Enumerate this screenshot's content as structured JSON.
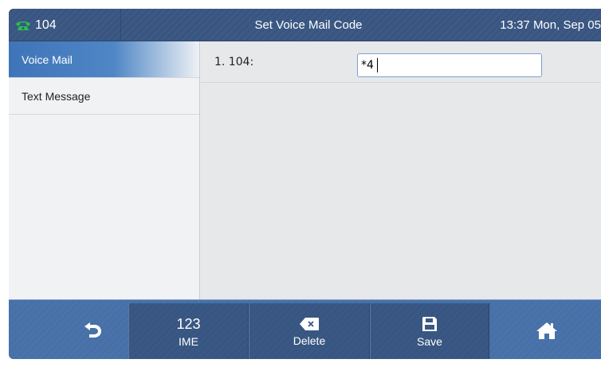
{
  "topbar": {
    "account": "104",
    "title": "Set Voice Mail Code",
    "clock": "13:37 Mon, Sep 05"
  },
  "sidebar": {
    "items": [
      {
        "label": "Voice Mail",
        "active": true
      },
      {
        "label": "Text Message",
        "active": false
      }
    ]
  },
  "content": {
    "rows": [
      {
        "label": "1. 104:",
        "value": "*4"
      }
    ]
  },
  "softkeys": {
    "back_icon": "back-arrow-icon",
    "ime_top": "123",
    "ime_label": "IME",
    "delete_icon": "backspace-icon",
    "delete_label": "Delete",
    "save_icon": "floppy-disk-icon",
    "save_label": "Save",
    "home_icon": "home-icon"
  },
  "colors": {
    "topbar": "#3b5883",
    "bottombar": "#4872a9",
    "accent": "#3f75b8",
    "phone_icon": "#27c24c"
  }
}
